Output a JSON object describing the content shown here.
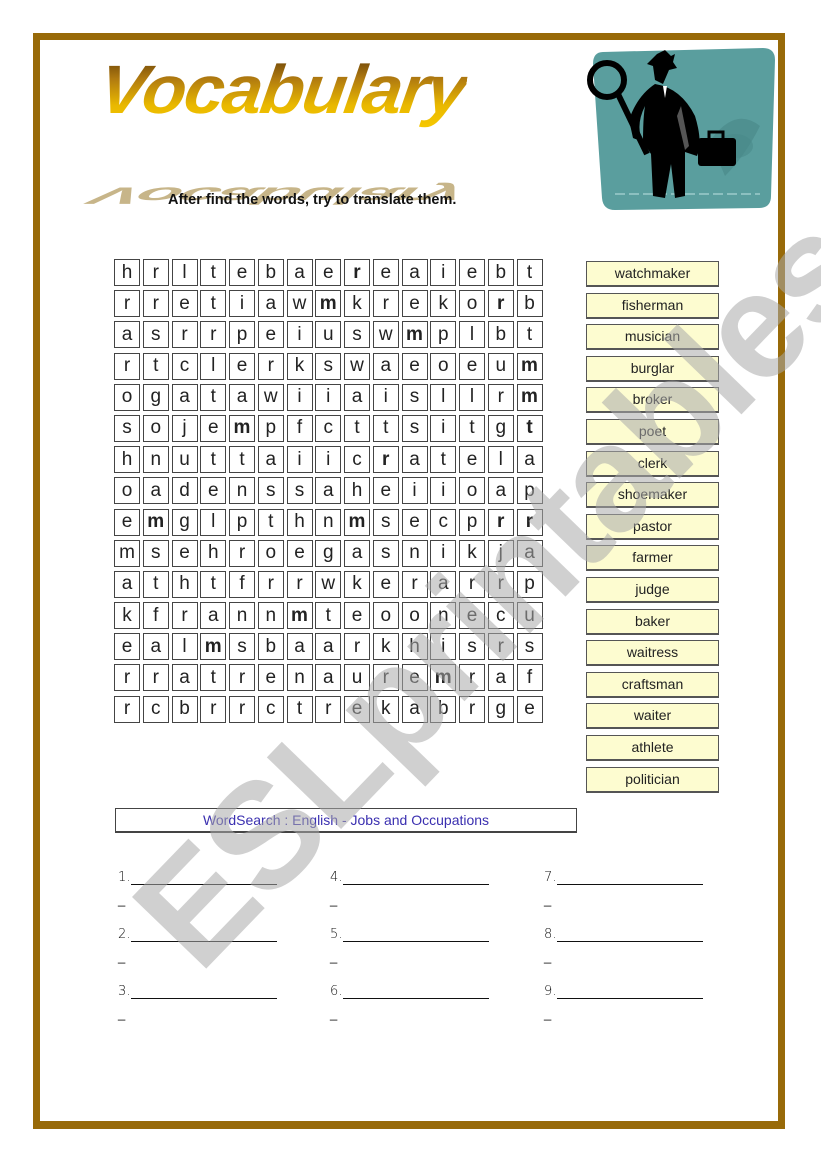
{
  "header": {
    "title": "Vocabulary",
    "instruction": "After find the words, try to translate them.",
    "clipart": "detective-icon"
  },
  "grid": [
    [
      "h",
      "r",
      "l",
      "t",
      "e",
      "b",
      "a",
      "e",
      "r",
      "e",
      "a",
      "i",
      "e",
      "b",
      "t"
    ],
    [
      "r",
      "r",
      "e",
      "t",
      "i",
      "a",
      "w",
      "m",
      "k",
      "r",
      "e",
      "k",
      "o",
      "r",
      "b"
    ],
    [
      "a",
      "s",
      "r",
      "r",
      "p",
      "e",
      "i",
      "u",
      "s",
      "w",
      "m",
      "p",
      "l",
      "b",
      "t"
    ],
    [
      "r",
      "t",
      "c",
      "l",
      "e",
      "r",
      "k",
      "s",
      "w",
      "a",
      "e",
      "o",
      "e",
      "u",
      "m"
    ],
    [
      "o",
      "g",
      "a",
      "t",
      "a",
      "w",
      "i",
      "i",
      "a",
      "i",
      "s",
      "l",
      "l",
      "r",
      "m"
    ],
    [
      "s",
      "o",
      "j",
      "e",
      "m",
      "p",
      "f",
      "c",
      "t",
      "t",
      "s",
      "i",
      "t",
      "g",
      "t"
    ],
    [
      "h",
      "n",
      "u",
      "t",
      "t",
      "a",
      "i",
      "i",
      "c",
      "r",
      "a",
      "t",
      "e",
      "l",
      "a"
    ],
    [
      "o",
      "a",
      "d",
      "e",
      "n",
      "s",
      "s",
      "a",
      "h",
      "e",
      "i",
      "i",
      "o",
      "a",
      "p"
    ],
    [
      "e",
      "m",
      "g",
      "l",
      "p",
      "t",
      "h",
      "n",
      "m",
      "s",
      "e",
      "c",
      "p",
      "r",
      "r"
    ],
    [
      "m",
      "s",
      "e",
      "h",
      "r",
      "o",
      "e",
      "g",
      "a",
      "s",
      "n",
      "i",
      "k",
      "j",
      "a"
    ],
    [
      "a",
      "t",
      "h",
      "t",
      "f",
      "r",
      "r",
      "w",
      "k",
      "e",
      "r",
      "a",
      "r",
      "r",
      "p"
    ],
    [
      "k",
      "f",
      "r",
      "a",
      "n",
      "n",
      "m",
      "t",
      "e",
      "o",
      "o",
      "n",
      "e",
      "c",
      "u"
    ],
    [
      "e",
      "a",
      "l",
      "m",
      "s",
      "b",
      "a",
      "a",
      "r",
      "k",
      "h",
      "i",
      "s",
      "r",
      "s"
    ],
    [
      "r",
      "r",
      "a",
      "t",
      "r",
      "e",
      "n",
      "a",
      "u",
      "r",
      "e",
      "m",
      "r",
      "a",
      "f"
    ],
    [
      "r",
      "c",
      "b",
      "r",
      "r",
      "c",
      "t",
      "r",
      "e",
      "k",
      "a",
      "b",
      "r",
      "g",
      "e"
    ]
  ],
  "word_list": [
    "watchmaker",
    "fisherman",
    "musician",
    "burglar",
    "broker",
    "poet",
    "clerk",
    "shoemaker",
    "pastor",
    "farmer",
    "judge",
    "baker",
    "waitress",
    "craftsman",
    "waiter",
    "athlete",
    "politician"
  ],
  "caption": "WordSearch : English - Jobs and Occupations",
  "answers": [
    {
      "label": "1.",
      "dash": "_"
    },
    {
      "label": "2.",
      "dash": "_"
    },
    {
      "label": "3.",
      "dash": "_"
    },
    {
      "label": "4.",
      "dash": "_"
    },
    {
      "label": "5.",
      "dash": "_"
    },
    {
      "label": "6.",
      "dash": "_"
    },
    {
      "label": "7.",
      "dash": "_"
    },
    {
      "label": "8.",
      "dash": "_"
    },
    {
      "label": "9.",
      "dash": "_"
    }
  ],
  "watermark": "ESLprintables.com",
  "colors": {
    "frame": "#986a09",
    "word_bg": "#fdfcd0",
    "caption_text": "#3a2fb0",
    "clipart_bg": "#5a9e9e"
  }
}
